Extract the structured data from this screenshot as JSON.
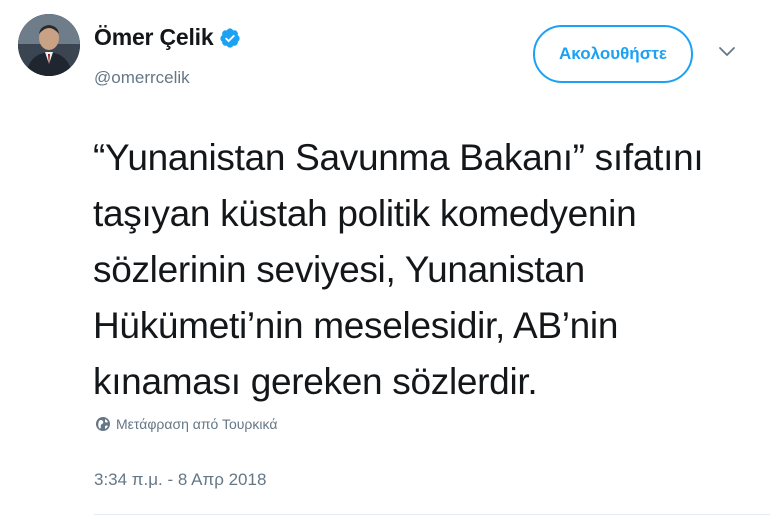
{
  "author": {
    "display_name": "Ömer Çelik",
    "handle": "@omerrcelik",
    "verified": true
  },
  "actions": {
    "follow_label": "Ακολουθήστε",
    "more_icon": "chevron-down-icon"
  },
  "tweet": {
    "text": "“Yunanistan Savunma Bakanı” sıfatını\ntaşıyan küstah politik komedyenin\nsözlerinin seviyesi, Yunanistan\nHükümeti’nin meselesidir, AB’nin\nkınaması gereken sözlerdir.",
    "translate_label": "Μετάφραση από Τουρκικά",
    "timestamp": "3:34 π.μ. - 8 Απρ 2018"
  },
  "colors": {
    "accent": "#1da1f2",
    "secondary_text": "#657786",
    "primary_text": "#14171a",
    "divider": "#e6ecf0"
  }
}
